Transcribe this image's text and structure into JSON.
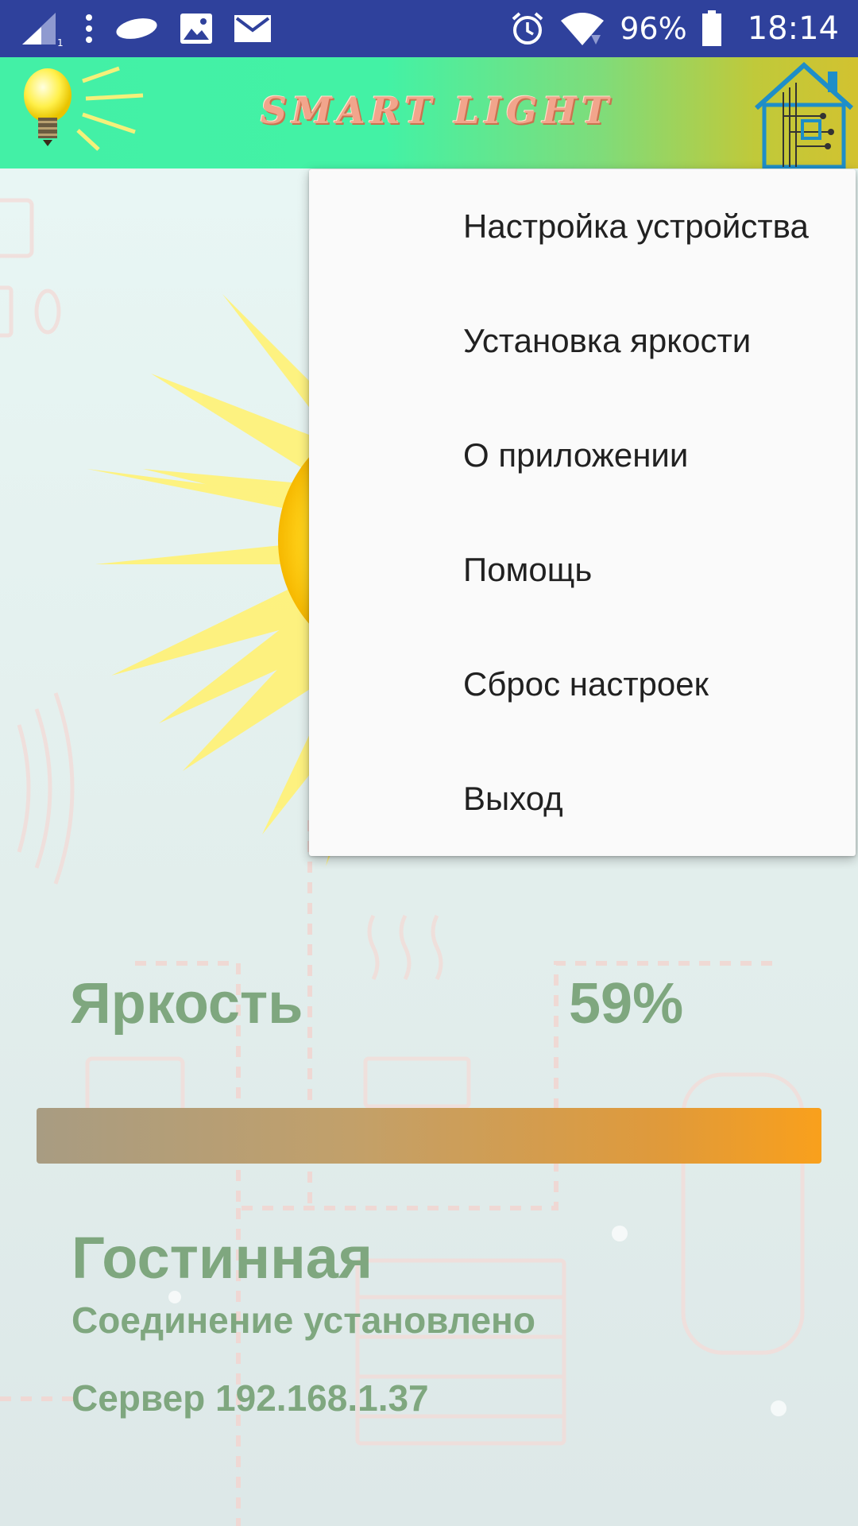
{
  "status_bar": {
    "battery": "96%",
    "time": "18:14"
  },
  "app": {
    "title": "SMART LIGHT"
  },
  "menu": {
    "items": [
      {
        "label": "Настройка устройства"
      },
      {
        "label": "Установка яркости"
      },
      {
        "label": "О приложении"
      },
      {
        "label": "Помощь"
      },
      {
        "label": "Сброс настроек"
      },
      {
        "label": "Выход"
      }
    ]
  },
  "brightness": {
    "label": "Яркость",
    "value_text": "59%",
    "value": 59
  },
  "room": {
    "name": "Гостинная",
    "connection_status": "Соединение установлено",
    "server_label": "Сервер",
    "server_ip": "192.168.1.37"
  },
  "colors": {
    "status_bar": "#2f419c",
    "app_bar_start": "#43f0a6",
    "app_bar_end": "#d2c230",
    "text_green": "#7fa77f",
    "slider_end": "#f9a01c",
    "menu_bg": "#fafafa"
  },
  "icons": {
    "status_left": [
      "signal-icon",
      "more-vert-icon",
      "cloud-icon",
      "image-icon",
      "mail-icon"
    ],
    "status_right": [
      "alarm-icon",
      "wifi-icon",
      "battery-icon"
    ],
    "app_left": "light-bulb-icon",
    "app_right": "smart-house-icon"
  }
}
